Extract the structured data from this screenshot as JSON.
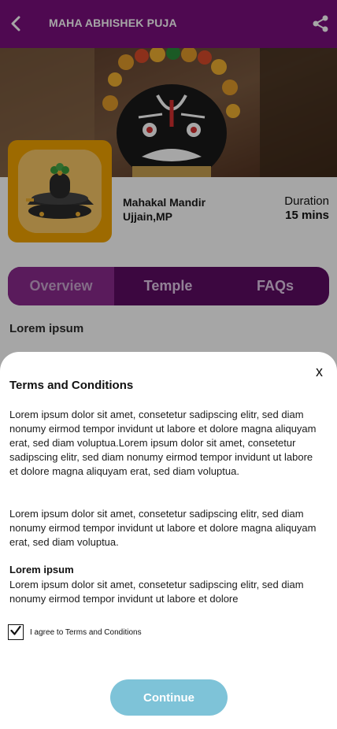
{
  "header": {
    "title": "MAHA ABHISHEK PUJA"
  },
  "temple": {
    "name_line1": "Mahakal Mandir",
    "name_line2": "Ujjain,MP",
    "duration_label": "Duration",
    "duration_value": "15 mins"
  },
  "tabs": [
    {
      "label": "Overview",
      "active": true
    },
    {
      "label": "Temple",
      "active": false
    },
    {
      "label": "FAQs",
      "active": false
    }
  ],
  "content": {
    "section_title": "Lorem ipsum"
  },
  "terms_modal": {
    "close_label": "x",
    "title": "Terms and Conditions",
    "paragraph1": "Lorem ipsum dolor sit amet, consetetur sadipscing elitr, sed diam nonumy eirmod tempor invidunt ut labore et dolore magna aliquyam erat, sed diam voluptua.Lorem ipsum dolor sit amet, consetetur sadipscing elitr, sed diam nonumy eirmod tempor invidunt ut labore et dolore magna aliquyam erat, sed diam voluptua.",
    "paragraph2": "Lorem ipsum dolor sit amet, consetetur sadipscing elitr, sed diam nonumy eirmod tempor invidunt ut labore et dolore magna aliquyam erat, sed diam voluptua.",
    "subheading": "Lorem ipsum",
    "paragraph3": "Lorem ipsum dolor sit amet, consetetur sadipscing elitr, sed diam nonumy eirmod tempor invidunt ut labore et dolore",
    "agree_label": "I agree to Terms and Conditions",
    "agree_checked": true,
    "continue_label": "Continue"
  },
  "colors": {
    "header_bg": "#7a0f7d",
    "tab_bg": "#5c0b63",
    "tab_active_bg": "#8a2a8e",
    "thumb_frame": "#f1a300",
    "continue_bg": "#7ec3d8"
  },
  "icons": {
    "back": "back-arrow-icon",
    "share": "share-icon",
    "check": "checkmark-icon"
  }
}
